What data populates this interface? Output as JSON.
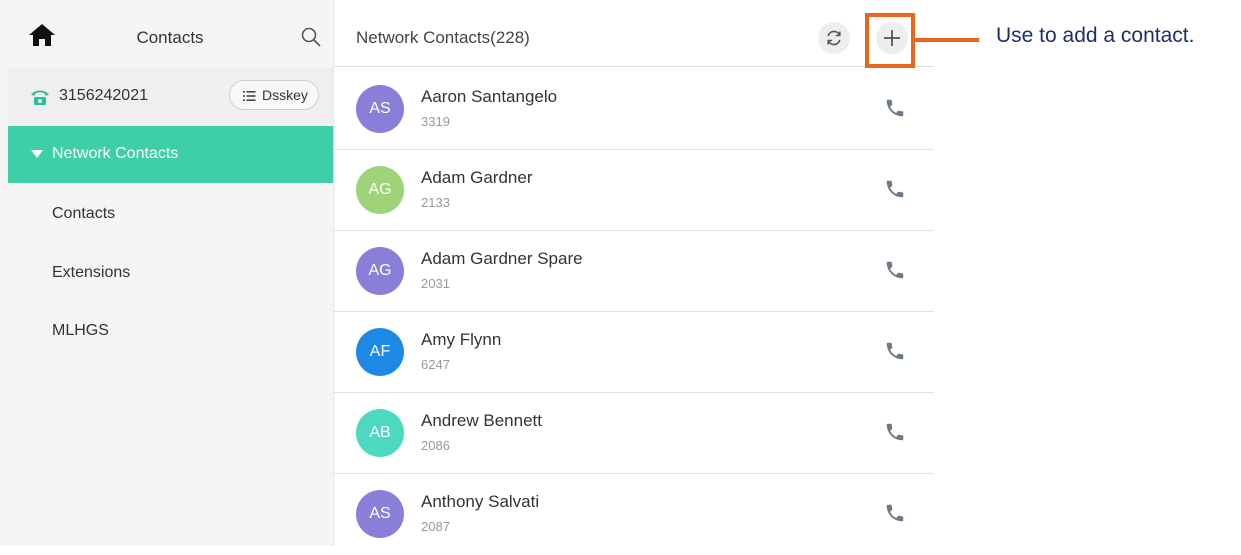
{
  "sidebar": {
    "title": "Contacts",
    "account": {
      "number": "3156242021",
      "dsskey_label": "Dsskey"
    },
    "group": {
      "label": "Network Contacts",
      "expanded": true
    },
    "items": [
      {
        "label": "Contacts"
      },
      {
        "label": "Extensions"
      },
      {
        "label": "MLHGS"
      }
    ]
  },
  "main": {
    "title": "Network Contacts(228)",
    "contacts": [
      {
        "initials": "AS",
        "name": "Aaron Santangelo",
        "ext": "3319",
        "color": "#8a7fd8"
      },
      {
        "initials": "AG",
        "name": "Adam Gardner",
        "ext": "2133",
        "color": "#9fd37a"
      },
      {
        "initials": "AG",
        "name": "Adam Gardner Spare",
        "ext": "2031",
        "color": "#8a7fd8"
      },
      {
        "initials": "AF",
        "name": "Amy Flynn",
        "ext": "6247",
        "color": "#1e88e5"
      },
      {
        "initials": "AB",
        "name": "Andrew Bennett",
        "ext": "2086",
        "color": "#4dd9c0"
      },
      {
        "initials": "AS",
        "name": "Anthony Salvati",
        "ext": "2087",
        "color": "#8a7fd8"
      }
    ]
  },
  "annotation": {
    "text": "Use to add a contact."
  },
  "colors": {
    "accent": "#3ecfa6",
    "callout": "#e8651f",
    "callout_text": "#1d2f6b"
  }
}
